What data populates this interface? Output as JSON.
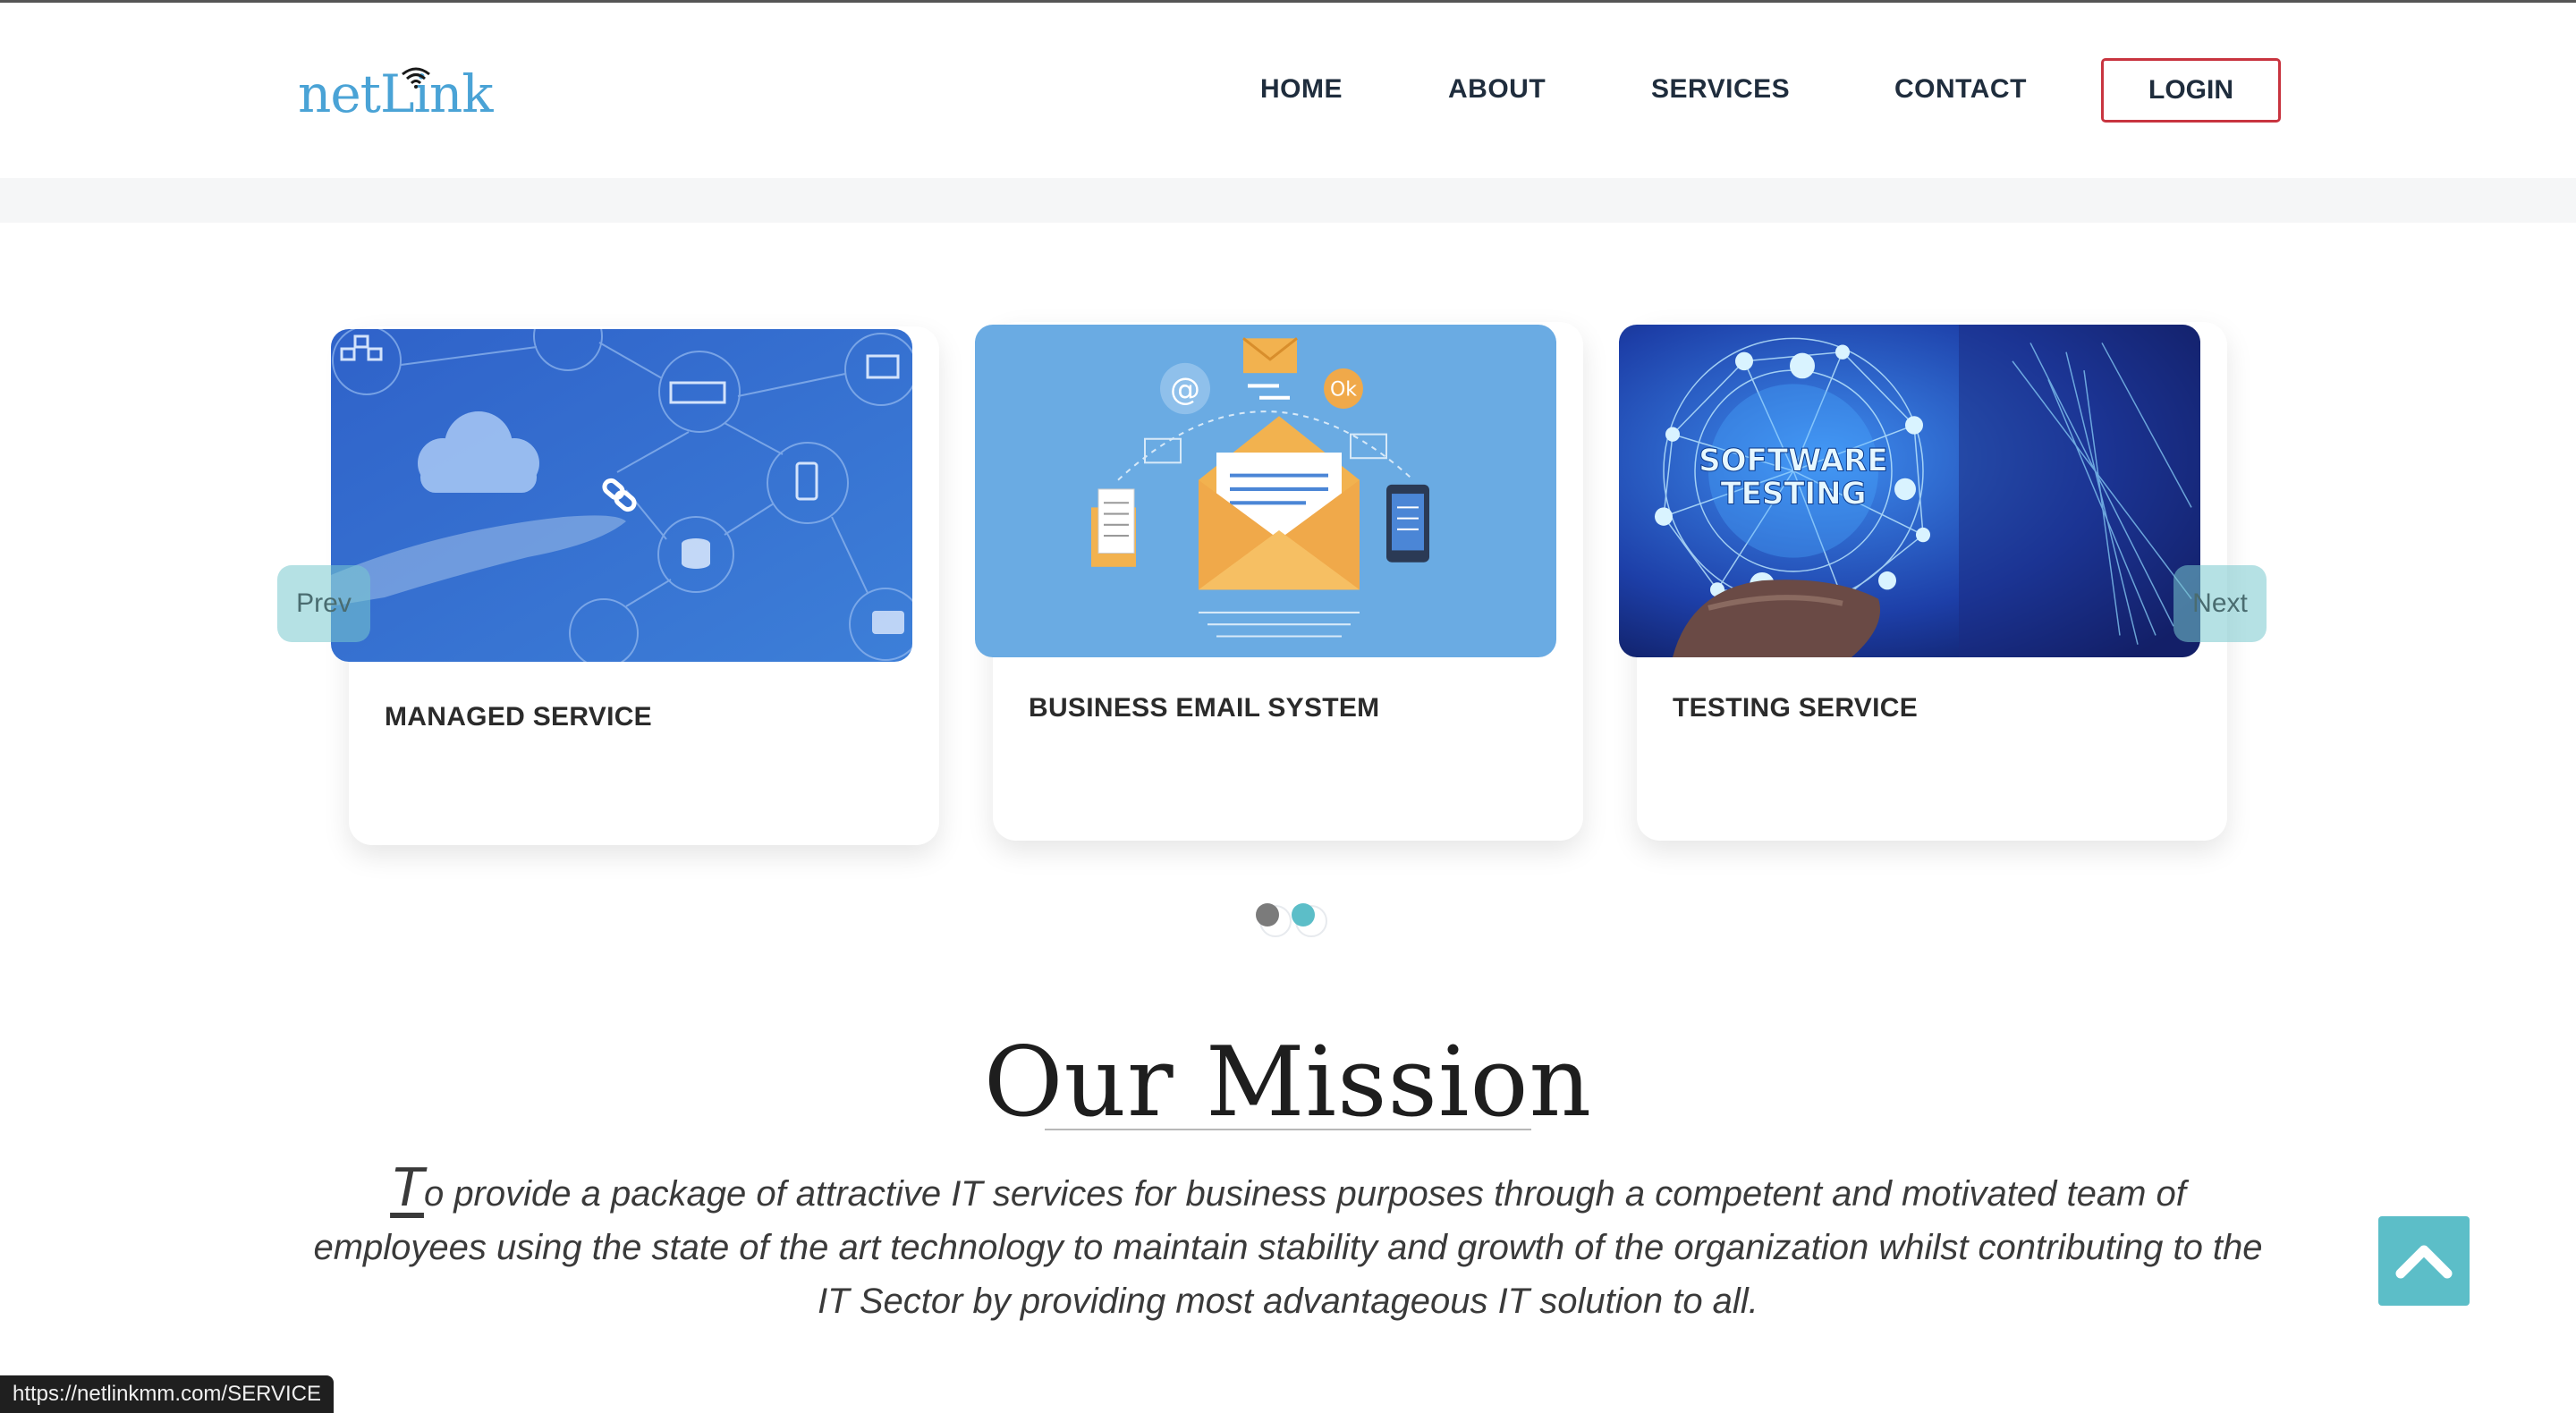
{
  "header": {
    "logo_text": "netLink",
    "nav": [
      "HOME",
      "ABOUT",
      "SERVICES",
      "CONTACT"
    ],
    "login_label": "LOGIN"
  },
  "carousel": {
    "prev_label": "Prev",
    "next_label": "Next",
    "cards": [
      {
        "title": "MANAGED SERVICE",
        "icon": "cloud-network-image"
      },
      {
        "title": "BUSINESS EMAIL SYSTEM",
        "icon": "email-envelope-image"
      },
      {
        "title": "TESTING SERVICE",
        "icon": "software-testing-image",
        "image_text": [
          "SOFTWARE",
          "TESTING"
        ]
      }
    ],
    "email_image_labels": {
      "at": "@",
      "ok": "Ok"
    },
    "active_dot": 2,
    "dot_count": 2
  },
  "mission": {
    "title": "Our Mission",
    "drop_cap": "T",
    "text": "o provide a package of attractive IT services for business purposes through a competent and motivated team of employees using the state of the art technology to maintain stability and growth of the organization whilst contributing to the IT Sector by providing most advantageous IT solution to all."
  },
  "status_bar": {
    "url": "https://netlinkmm.com/SERVICE"
  },
  "colors": {
    "brand": "#4aa3d6",
    "login_border": "#c8343f",
    "accent": "#5cbec8"
  }
}
